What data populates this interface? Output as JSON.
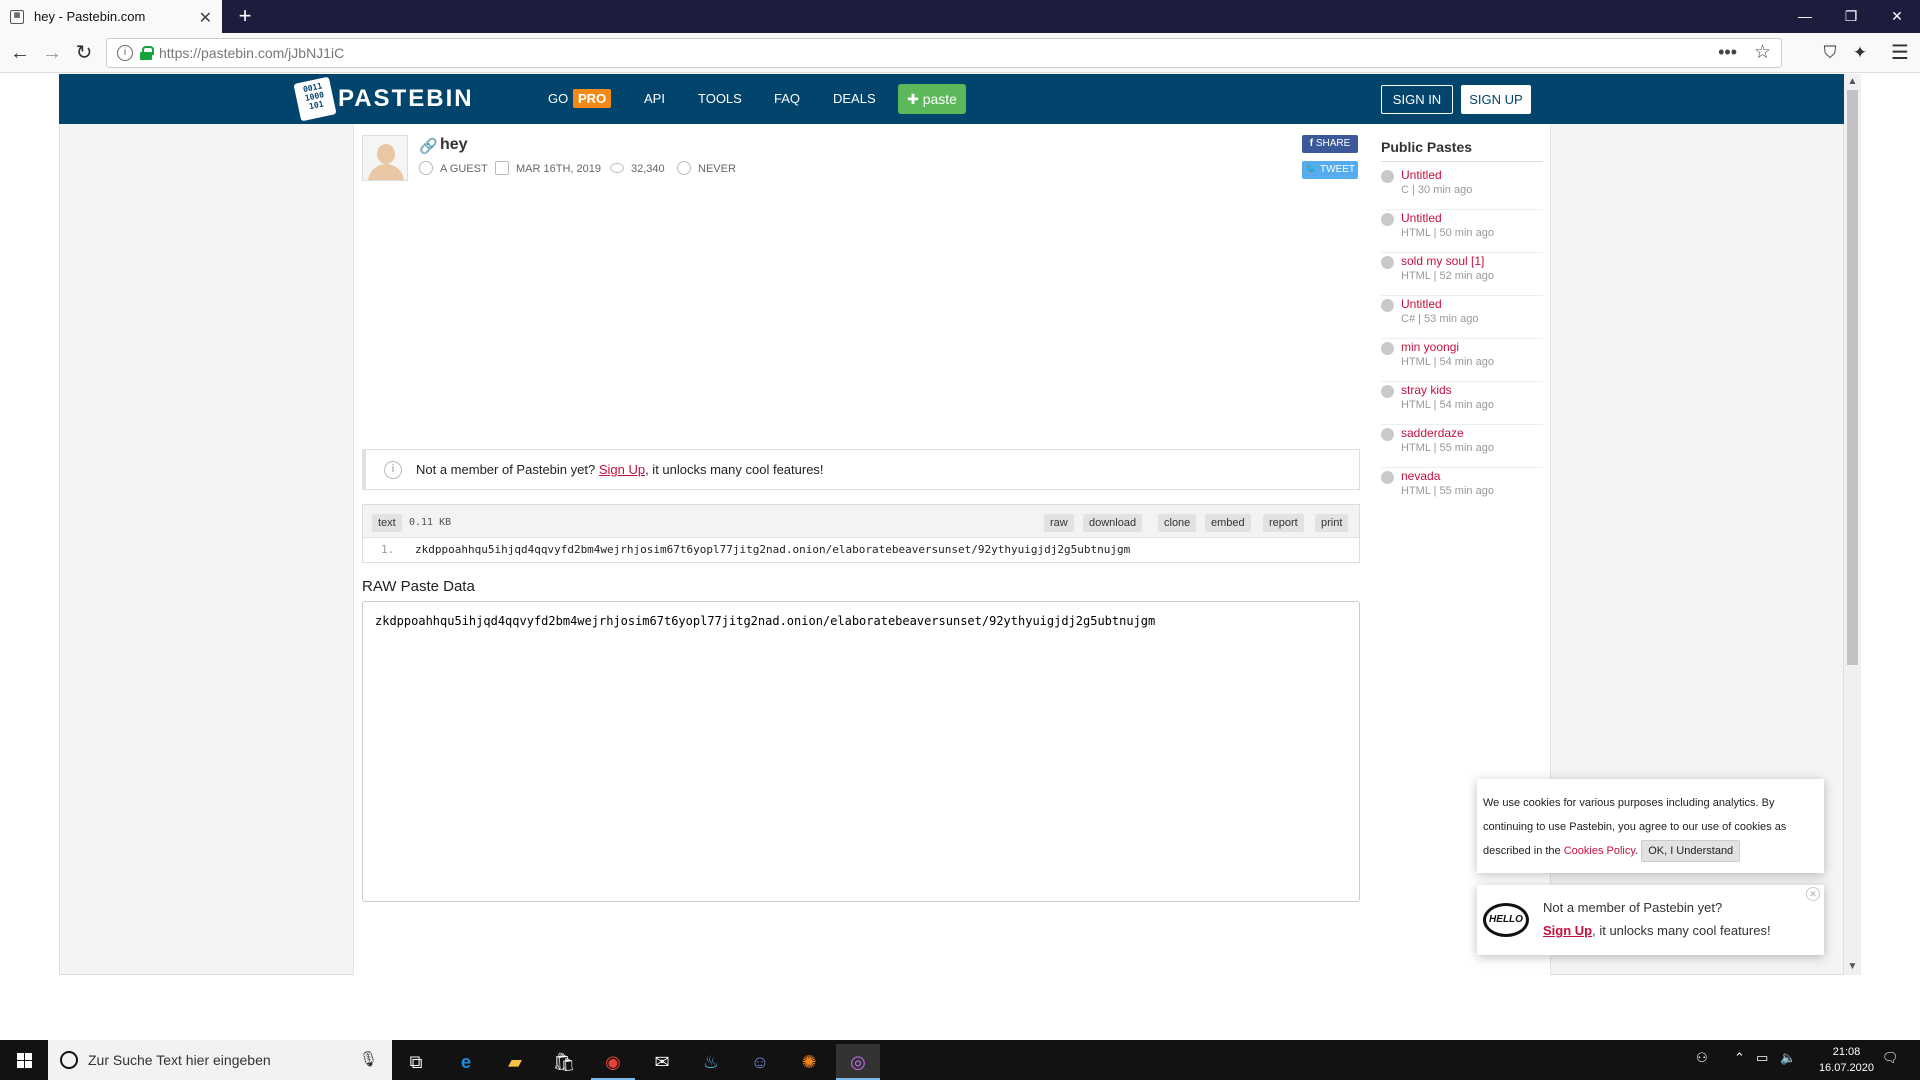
{
  "browser": {
    "tab_title": "hey - Pastebin.com",
    "tab_icon": "pastebin-favicon",
    "url": "https://pastebin.com/jJbNJ1iC",
    "window_buttons": [
      "—",
      "❐",
      "✕"
    ]
  },
  "header": {
    "logo_icon": "0011\n1000\n101",
    "logo_text": "PASTEBIN",
    "nav": {
      "go": "GO",
      "pro": "PRO",
      "api": "API",
      "tools": "TOOLS",
      "faq": "FAQ",
      "deals": "DEALS",
      "paste": "paste"
    },
    "sign_in": "SIGN IN",
    "sign_up": "SIGN UP",
    "colors": {
      "bar": "#02456c",
      "pro": "#f28a19",
      "paste": "#5bb85b"
    }
  },
  "paste": {
    "title": "hey",
    "author": "A GUEST",
    "date": "MAR 16TH, 2019",
    "views": "32,340",
    "expire": "NEVER",
    "share": "SHARE",
    "tweet": "TWEET",
    "syntax": "text",
    "size": "0.11 KB",
    "actions": [
      "raw",
      "download",
      "clone",
      "embed",
      "report",
      "print"
    ],
    "line_number": "1.",
    "content": "zkdppoahhqu5ihjqd4qqvyfd2bm4wejrhjosim67t6yopl77jitg2nad.onion/elaboratebeaversunset/92ythyuigjdj2g5ubtnujgm",
    "raw_heading": "RAW Paste Data"
  },
  "notice": {
    "prefix": "Not a member of Pastebin yet?",
    "link": "Sign Up",
    "suffix": ", it unlocks many cool features!"
  },
  "sidebar": {
    "title": "Public Pastes",
    "items": [
      {
        "title": "Untitled",
        "meta": "C | 30 min ago"
      },
      {
        "title": "Untitled",
        "meta": "HTML | 50 min ago"
      },
      {
        "title": "sold my soul [1]",
        "meta": "HTML | 52 min ago"
      },
      {
        "title": "Untitled",
        "meta": "C# | 53 min ago"
      },
      {
        "title": "min yoongi",
        "meta": "HTML | 54 min ago"
      },
      {
        "title": "stray kids",
        "meta": "HTML | 54 min ago"
      },
      {
        "title": "sadderdaze",
        "meta": "HTML | 55 min ago"
      },
      {
        "title": "nevada",
        "meta": "HTML | 55 min ago"
      }
    ]
  },
  "cookie": {
    "text1": "We use cookies for various purposes including analytics. By continuing to use Pastebin, you agree to our use of cookies as described in the",
    "link": "Cookies Policy",
    "dot": ".",
    "button": "OK, I Understand"
  },
  "hello_popup": {
    "bubble": "HELLO",
    "line1": "Not a member of Pastebin yet?",
    "link": "Sign Up",
    "line2_suffix": ", it unlocks many cool features!"
  },
  "taskbar": {
    "search_placeholder": "Zur Suche Text hier eingeben",
    "time": "21:08",
    "date": "16.07.2020",
    "apps": [
      "task-view-icon",
      "edge-icon",
      "file-explorer-icon",
      "store-icon",
      "chrome-icon",
      "mail-icon",
      "steam-icon",
      "discord-icon",
      "metamask-icon",
      "tor-icon"
    ]
  }
}
